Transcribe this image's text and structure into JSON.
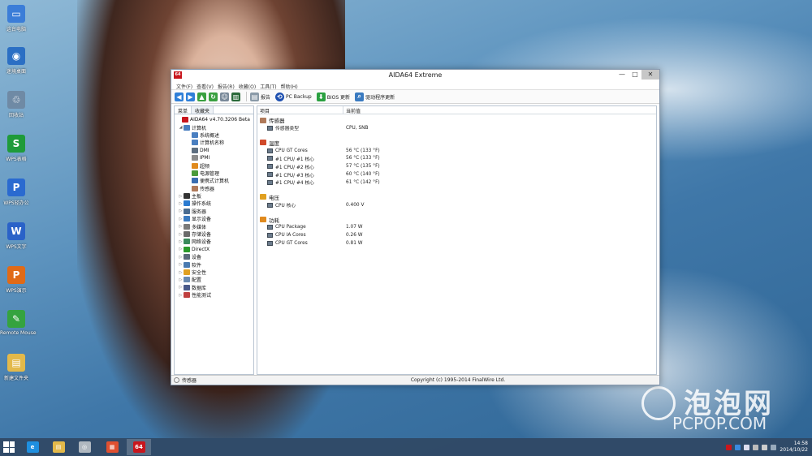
{
  "desktop": {
    "icons": [
      {
        "label": "这台电脑",
        "icon": "computer-icon",
        "color": "#3b7dd8",
        "glyph": "▭"
      },
      {
        "label": "迷境桌面",
        "icon": "desktop-globe-icon",
        "color": "#2b6fc4",
        "glyph": "◉"
      },
      {
        "label": "回收站",
        "icon": "recycle-bin-icon",
        "color": "#6f8aa5",
        "glyph": "♲"
      },
      {
        "label": "WPS表格",
        "icon": "wps-spreadsheet-icon",
        "color": "#1f9b3a",
        "glyph": "S"
      },
      {
        "label": "WPS轻办公",
        "icon": "wps-light-office-icon",
        "color": "#2a6ad0",
        "glyph": "P"
      },
      {
        "label": "WPS文字",
        "icon": "wps-writer-icon",
        "color": "#2a62c8",
        "glyph": "W"
      },
      {
        "label": "WPS演示",
        "icon": "wps-presentation-icon",
        "color": "#e06a17",
        "glyph": "P"
      },
      {
        "label": "Remote Mouse",
        "icon": "remote-mouse-icon",
        "color": "#35a33f",
        "glyph": "✎"
      },
      {
        "label": "新建文件夹",
        "icon": "folder-icon",
        "color": "#e3b94a",
        "glyph": "▤"
      }
    ],
    "watermark_cn": "泡泡网",
    "watermark_en": "PCPOP.COM"
  },
  "window": {
    "app_icon_text": "64",
    "title": "AIDA64 Extreme",
    "controls": {
      "minimize": "—",
      "maximize": "□",
      "close": "✕"
    },
    "menu": [
      "文件(F)",
      "查看(V)",
      "报告(R)",
      "收藏(O)",
      "工具(T)",
      "帮助(H)"
    ],
    "toolbar": {
      "report": "报告",
      "pc_backup": "PC Backup",
      "bios_update": "BIOS 更新",
      "driver_update": "驱动程序更新"
    },
    "left_tabs": [
      "菜单",
      "收藏夹"
    ],
    "tree": [
      {
        "label": "AIDA64 v4.70.3206 Beta",
        "level": 0,
        "exp": "",
        "color": "#c8161d"
      },
      {
        "label": "计算机",
        "level": 1,
        "exp": "◢",
        "color": "#4a7fc0"
      },
      {
        "label": "系统概述",
        "level": 2,
        "exp": "",
        "color": "#4a7fc0"
      },
      {
        "label": "计算机名称",
        "level": 2,
        "exp": "",
        "color": "#4a7fc0"
      },
      {
        "label": "DMI",
        "level": 2,
        "exp": "",
        "color": "#5d6e80"
      },
      {
        "label": "IPMI",
        "level": 2,
        "exp": "",
        "color": "#8c8c8c"
      },
      {
        "label": "超频",
        "level": 2,
        "exp": "",
        "color": "#e08a1e"
      },
      {
        "label": "电源管理",
        "level": 2,
        "exp": "",
        "color": "#4a9a3a"
      },
      {
        "label": "便携式计算机",
        "level": 2,
        "exp": "",
        "color": "#3a6db0"
      },
      {
        "label": "传感器",
        "level": 2,
        "exp": "",
        "color": "#b07a5a"
      },
      {
        "label": "主板",
        "level": 1,
        "exp": "▷",
        "color": "#333"
      },
      {
        "label": "操作系统",
        "level": 1,
        "exp": "▷",
        "color": "#2a7ad0"
      },
      {
        "label": "服务器",
        "level": 1,
        "exp": "▷",
        "color": "#4a6c90"
      },
      {
        "label": "显示设备",
        "level": 1,
        "exp": "▷",
        "color": "#3a7ac0"
      },
      {
        "label": "多媒体",
        "level": 1,
        "exp": "▷",
        "color": "#7a7a7a"
      },
      {
        "label": "存储设备",
        "level": 1,
        "exp": "▷",
        "color": "#6a6a6a"
      },
      {
        "label": "网络设备",
        "level": 1,
        "exp": "▷",
        "color": "#3a8a5a"
      },
      {
        "label": "DirectX",
        "level": 1,
        "exp": "▷",
        "color": "#2a9a2a"
      },
      {
        "label": "设备",
        "level": 1,
        "exp": "▷",
        "color": "#5a6a7a"
      },
      {
        "label": "软件",
        "level": 1,
        "exp": "▷",
        "color": "#4a7ab0"
      },
      {
        "label": "安全性",
        "level": 1,
        "exp": "▷",
        "color": "#e0a020"
      },
      {
        "label": "配置",
        "level": 1,
        "exp": "▷",
        "color": "#6a8ab0"
      },
      {
        "label": "数据库",
        "level": 1,
        "exp": "▷",
        "color": "#4a5a8a"
      },
      {
        "label": "性能测试",
        "level": 1,
        "exp": "▷",
        "color": "#c04040"
      }
    ],
    "columns": {
      "item": "项目",
      "value": "当前值"
    },
    "sections": [
      {
        "title": "传感器",
        "icon_color": "#b07a5a",
        "rows": [
          {
            "label": "传感器类型",
            "value": "CPU, SNB"
          }
        ]
      },
      {
        "title": "温度",
        "icon_color": "#d04a2a",
        "rows": [
          {
            "label": "CPU GT Cores",
            "value": "56 °C  (133 °F)"
          },
          {
            "label": "#1 CPU/ #1 核心",
            "value": "56 °C  (133 °F)"
          },
          {
            "label": "#1 CPU/ #2 核心",
            "value": "57 °C  (135 °F)"
          },
          {
            "label": "#1 CPU/ #3 核心",
            "value": "60 °C  (140 °F)"
          },
          {
            "label": "#1 CPU/ #4 核心",
            "value": "61 °C  (142 °F)"
          }
        ]
      },
      {
        "title": "电压",
        "icon_color": "#e0a020",
        "rows": [
          {
            "label": "CPU 核心",
            "value": "0.400 V"
          }
        ]
      },
      {
        "title": "功耗",
        "icon_color": "#e08a1e",
        "rows": [
          {
            "label": "CPU Package",
            "value": "1.07 W"
          },
          {
            "label": "CPU IA Cores",
            "value": "0.26 W"
          },
          {
            "label": "CPU GT Cores",
            "value": "0.81 W"
          }
        ]
      }
    ],
    "status": {
      "left": "传感器",
      "right": "Copyright (c) 1995-2014 FinalWire Ltd."
    }
  },
  "taskbar": {
    "clock_time": "14:58",
    "clock_date": "2014/10/22",
    "apps": [
      {
        "name": "ie-icon",
        "color": "#1e8fe0",
        "glyph": "e"
      },
      {
        "name": "file-explorer-icon",
        "color": "#e3b94a",
        "glyph": "▤"
      },
      {
        "name": "media-icon",
        "color": "#b0b8c0",
        "glyph": "◎"
      },
      {
        "name": "colorful-app-icon",
        "color": "#e05030",
        "glyph": "▦"
      },
      {
        "name": "aida64-icon",
        "color": "#c8161d",
        "glyph": "64"
      }
    ]
  }
}
